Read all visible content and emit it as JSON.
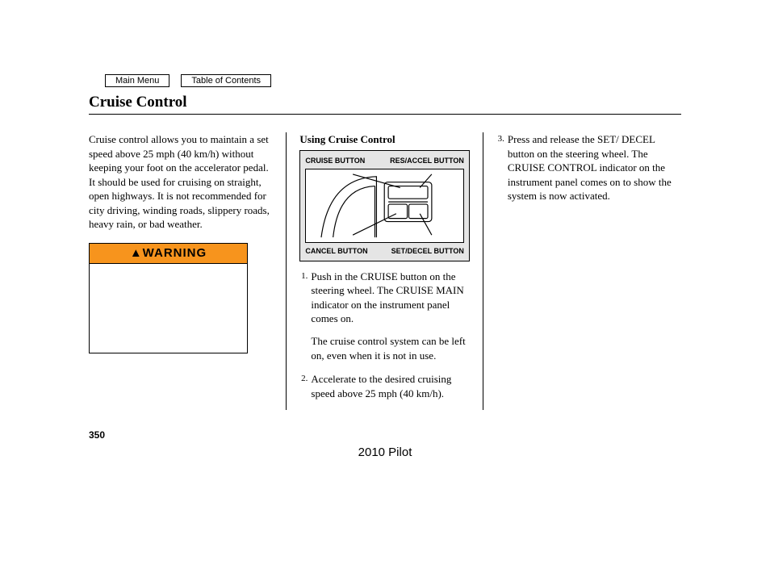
{
  "nav": {
    "main_menu": "Main Menu",
    "toc": "Table of Contents"
  },
  "title": "Cruise Control",
  "col1": {
    "intro": "Cruise control allows you to maintain a set speed above 25 mph (40 km/h) without keeping your foot on the accelerator pedal. It should be used for cruising on straight, open highways. It is not recommended for city driving, winding roads, slippery roads, heavy rain, or bad weather.",
    "warning_label": "WARNING"
  },
  "col2": {
    "subhead": "Using Cruise Control",
    "diagram": {
      "label_top_left": "CRUISE BUTTON",
      "label_top_right": "RES/ACCEL BUTTON",
      "label_bottom_left": "CANCEL BUTTON",
      "label_bottom_right": "SET/DECEL BUTTON"
    },
    "steps": [
      {
        "n": "1.",
        "text": "Push in the CRUISE button on the steering wheel. The CRUISE MAIN indicator on the instrument panel comes on.",
        "para2": "The cruise control system can be left on, even when it is not in use."
      },
      {
        "n": "2.",
        "text": "Accelerate to the desired cruising speed above 25 mph (40 km/h)."
      }
    ]
  },
  "col3": {
    "steps": [
      {
        "n": "3.",
        "text": "Press and release the SET/ DECEL button on the steering wheel. The CRUISE CONTROL indicator on the instrument panel comes on to show the system is now activated."
      }
    ]
  },
  "page_number": "350",
  "footer": "2010 Pilot"
}
